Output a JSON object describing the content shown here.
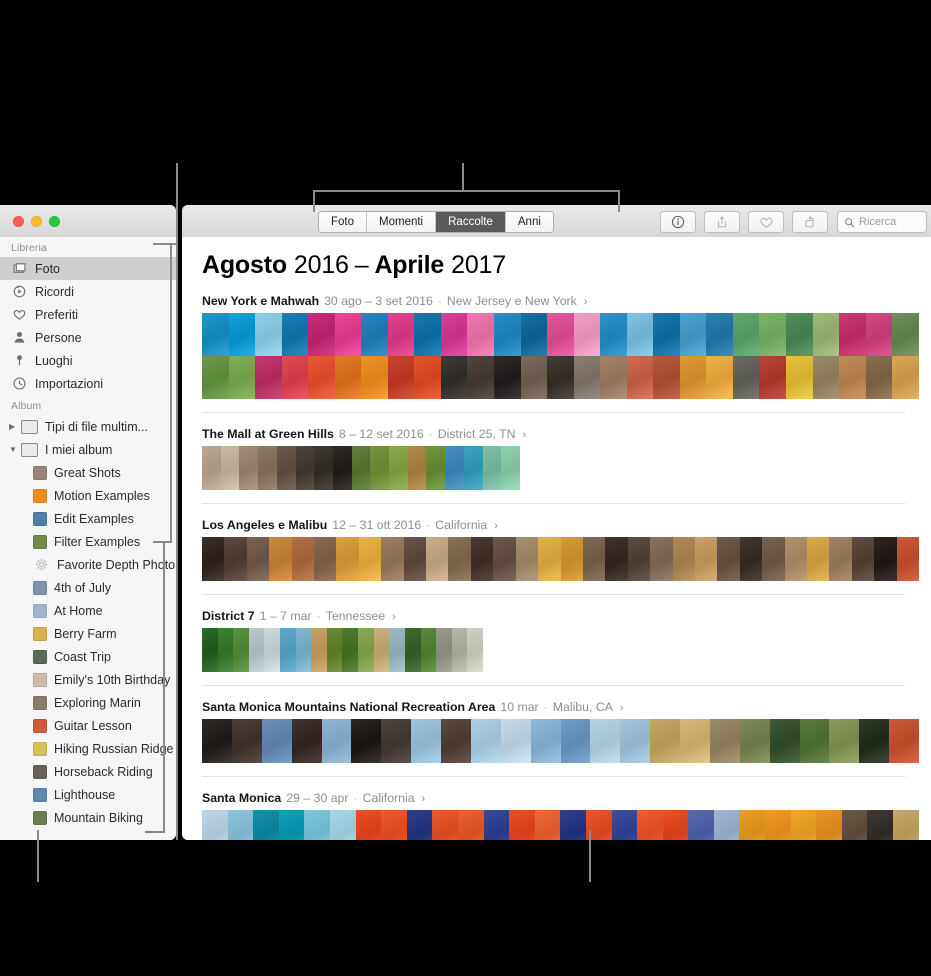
{
  "window": {
    "traffic_lights": [
      "close",
      "minimize",
      "zoom"
    ]
  },
  "sidebar": {
    "sections": [
      {
        "header": "Libreria",
        "items": [
          {
            "label": "Foto",
            "icon": "photos-icon",
            "selected": true
          },
          {
            "label": "Ricordi",
            "icon": "memories-icon",
            "selected": false
          },
          {
            "label": "Preferiti",
            "icon": "heart-icon",
            "selected": false
          },
          {
            "label": "Persone",
            "icon": "person-icon",
            "selected": false
          },
          {
            "label": "Luoghi",
            "icon": "pin-icon",
            "selected": false
          },
          {
            "label": "Importazioni",
            "icon": "clock-icon",
            "selected": false
          }
        ]
      },
      {
        "header": "Album",
        "items": [
          {
            "label": "Tipi di file multim...",
            "icon": "folder-icon",
            "twisty": "collapsed",
            "color": "#e9e9e9"
          },
          {
            "label": "I miei album",
            "icon": "folder-icon",
            "twisty": "expanded",
            "color": "#e9e9e9"
          },
          {
            "label": "Great Shots",
            "icon": "album-thumb",
            "color": "#9a8578"
          },
          {
            "label": "Motion Examples",
            "icon": "album-thumb",
            "color": "#ef8b1f"
          },
          {
            "label": "Edit Examples",
            "icon": "album-thumb",
            "color": "#4e7fa8"
          },
          {
            "label": "Filter Examples",
            "icon": "album-thumb",
            "color": "#6f8a46"
          },
          {
            "label": "Favorite Depth Photo",
            "icon": "gear-icon",
            "color": "#d8d8d8"
          },
          {
            "label": "4th of July",
            "icon": "album-thumb",
            "color": "#7f93ab"
          },
          {
            "label": "At Home",
            "icon": "album-thumb",
            "color": "#9fb4cc"
          },
          {
            "label": "Berry Farm",
            "icon": "album-thumb",
            "color": "#d9b24c"
          },
          {
            "label": "Coast Trip",
            "icon": "album-thumb",
            "color": "#5c6b55"
          },
          {
            "label": "Emily's 10th Birthday",
            "icon": "album-thumb",
            "color": "#cbb9a3"
          },
          {
            "label": "Exploring Marin",
            "icon": "album-thumb",
            "color": "#8a7b66"
          },
          {
            "label": "Guitar Lesson",
            "icon": "album-thumb",
            "color": "#cf5a3a"
          },
          {
            "label": "Hiking Russian Ridge",
            "icon": "album-thumb",
            "color": "#d5c25a"
          },
          {
            "label": "Horseback Riding",
            "icon": "album-thumb",
            "color": "#6b6257"
          },
          {
            "label": "Lighthouse",
            "icon": "album-thumb",
            "color": "#5f87b2"
          },
          {
            "label": "Mountain Biking",
            "icon": "album-thumb",
            "color": "#6e7c4e"
          }
        ]
      }
    ]
  },
  "toolbar": {
    "tabs": [
      {
        "label": "Foto",
        "active": false
      },
      {
        "label": "Momenti",
        "active": false
      },
      {
        "label": "Raccolte",
        "active": true
      },
      {
        "label": "Anni",
        "active": false
      }
    ],
    "buttons": [
      {
        "name": "info-button",
        "icon": "info-icon"
      },
      {
        "name": "share-button",
        "icon": "share-icon"
      },
      {
        "name": "favorite-button",
        "icon": "heart-icon"
      },
      {
        "name": "rotate-button",
        "icon": "rotate-icon"
      }
    ],
    "search": {
      "placeholder": "Ricerca",
      "value": "",
      "icon": "search-icon"
    }
  },
  "main": {
    "title": {
      "month_start": "Agosto",
      "year_start": "2016",
      "dash": "–",
      "month_end": "Aprile",
      "year_end": "2017"
    },
    "sections": [
      {
        "title": "New York e Mahwah",
        "date": "30 ago – 3 set 2016",
        "place": "New Jersey e New York",
        "chevron": "›",
        "strip_height": 86,
        "strip_width": 717,
        "rows": 2,
        "cells": [
          [
            "#2596c8",
            "#18a0d8",
            "#8fd0e8",
            "#1f7fb4",
            "#c8317a",
            "#e8489a",
            "#2a86bd",
            "#e0458f",
            "#1d79ad",
            "#d9419a",
            "#f07ab0",
            "#2b8fc6",
            "#1b6fa4",
            "#e3579c",
            "#f2a0c3",
            "#2f93c9",
            "#7fc3e2",
            "#1e78ad",
            "#4ea4cf",
            "#2f7fb0",
            "#62a86f",
            "#7cb46e",
            "#548f5c",
            "#9ebb7c",
            "#c73b72",
            "#d44a85",
            "#6e8e5a"
          ],
          [
            "#6d9a4a",
            "#7fae58",
            "#c23a6d",
            "#e04b55",
            "#ea5a3a",
            "#e07a2a",
            "#f0922a",
            "#c8462f",
            "#e2552f",
            "#3d3a38",
            "#51453f",
            "#2f2c2b",
            "#7a6a5c",
            "#453c36",
            "#8a7f74",
            "#a3836a",
            "#d06a52",
            "#b45a3f",
            "#e09a3a",
            "#ebb04a",
            "#6b6a63",
            "#b8453a",
            "#e5c23f",
            "#9b8a6a",
            "#c08a5a",
            "#8a7050",
            "#d8a659"
          ]
        ]
      },
      {
        "title": "The Mall at Green Hills",
        "date": "8 – 12 set 2016",
        "place": "District 25, TN",
        "chevron": "›",
        "strip_height": 44,
        "strip_width": 318,
        "rows": 1,
        "cells": [
          [
            "#b9a894",
            "#c8b9a2",
            "#a08d76",
            "#8d7b64",
            "#6a5c4c",
            "#4e463c",
            "#3f3a33",
            "#2f2b27",
            "#5f7f3a",
            "#79953f",
            "#8aa84c",
            "#b08a4a",
            "#6f9740",
            "#4a8fbd",
            "#3fa3c0",
            "#7fc0a8",
            "#8fd0b0"
          ]
        ]
      },
      {
        "title": "Los Angeles e Malibu",
        "date": "12 – 31 ott 2016",
        "place": "California",
        "chevron": "›",
        "strip_height": 44,
        "strip_width": 717,
        "rows": 1,
        "cells": [
          [
            "#3a2f2b",
            "#5a4a42",
            "#7a6254",
            "#c98a3f",
            "#b0724a",
            "#8a6a52",
            "#d9a03f",
            "#e8b44a",
            "#9a7f63",
            "#6a5348",
            "#c9ad8a",
            "#8a7058",
            "#4a3b33",
            "#6d5a4c",
            "#a88f72",
            "#e0b24a",
            "#d49a3a",
            "#7f6a55",
            "#3f342e",
            "#5c4d42",
            "#8a7260",
            "#b08a5a",
            "#caa06a",
            "#6f5c4d",
            "#43382f",
            "#7a6352",
            "#b2916d",
            "#d8a94f",
            "#9f8363",
            "#5f4d40",
            "#2f2724",
            "#c85a3a"
          ]
        ]
      },
      {
        "title": "District 7",
        "date": "1 – 7 mar",
        "place": "Tennessee",
        "chevron": "›",
        "strip_height": 44,
        "strip_width": 281,
        "rows": 1,
        "cells": [
          [
            "#2f6a2a",
            "#3f8035",
            "#5a9440",
            "#b9c8cf",
            "#cdd8dd",
            "#5fa8c8",
            "#7fb8d0",
            "#c9a06a",
            "#6a8a3a",
            "#4f7a2f",
            "#8aa85a",
            "#c9b07a",
            "#9fb8c8",
            "#3f6a35",
            "#5a8a40",
            "#9a9a8a",
            "#b5b5a8",
            "#cfcfc4"
          ]
        ]
      },
      {
        "title": "Santa Monica Mountains National Recreation Area",
        "date": "10 mar",
        "place": "Malibu, CA",
        "chevron": "›",
        "strip_height": 44,
        "strip_width": 717,
        "rows": 1,
        "cells": [
          [
            "#2f2a28",
            "#4a3f39",
            "#6a8fb8",
            "#3f3430",
            "#8fb4d4",
            "#2b2523",
            "#4f4540",
            "#9fc4dd",
            "#5a4a42",
            "#aecfe4",
            "#c3dbea",
            "#8fb8d8",
            "#6f9cc4",
            "#b7d4e6",
            "#a3c4dd",
            "#c8a86a",
            "#d8b87a",
            "#9a8a6a",
            "#7f8a5a",
            "#3f5a35",
            "#5a7a40",
            "#8a9a5a",
            "#2f3a2a",
            "#c95a3a"
          ]
        ]
      },
      {
        "title": "Santa Monica",
        "date": "29 – 30 apr",
        "place": "California",
        "chevron": "›",
        "strip_height": 44,
        "strip_width": 717,
        "rows": 1,
        "cells": [
          [
            "#bcd8e8",
            "#8fc4dd",
            "#1a8fa8",
            "#17a0b8",
            "#7fc8dd",
            "#a8d8e8",
            "#e8502a",
            "#ec5a2f",
            "#2f3f8a",
            "#e85a2f",
            "#ea6234",
            "#3a4a9a",
            "#e8502a",
            "#ee6a3a",
            "#2f3f8a",
            "#e8562f",
            "#3f4fa0",
            "#ec5e32",
            "#e8502a",
            "#5a6ab0",
            "#9fb8d4",
            "#e8a02a",
            "#ef9a2a",
            "#f0a82f",
            "#e8952a",
            "#6a5a4a",
            "#3f3a35",
            "#c8a86a"
          ]
        ]
      }
    ]
  }
}
